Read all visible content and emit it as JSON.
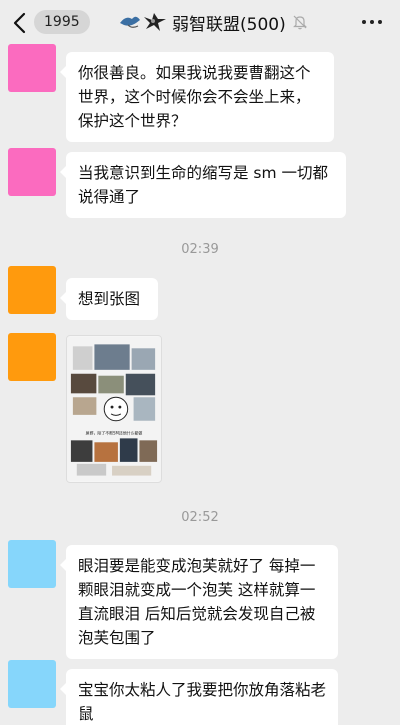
{
  "header": {
    "back_count": "1995",
    "title": "弱智联盟(500)"
  },
  "colors": {
    "pink": "#fb6bbf",
    "orange": "#ff9a0d",
    "blue": "#86d6fb",
    "bubble": "#ffffff",
    "background": "#ededed"
  },
  "icons": {
    "back": "chevron-left-icon",
    "group": "group-avatar-icon",
    "mute": "bell-off-icon",
    "more": "ellipsis-icon"
  },
  "messages": [
    {
      "avatar_color": "pink",
      "text": "你很善良。如果我说我要曹翻这个世界，这个时候你会不会坐上来，保护这个世界？"
    },
    {
      "avatar_color": "pink",
      "text": "当我意识到生命的缩写是 sm 一切都说得通了"
    },
    {
      "avatar_color": "orange",
      "text": "想到张图"
    },
    {
      "avatar_color": "orange",
      "image_caption": "屌群，除了不断SM还他什么都做",
      "image_label": "collage-image"
    },
    {
      "avatar_color": "blue",
      "text": "眼泪要是能变成泡芙就好了 每掉一颗眼泪就变成一个泡芙 这样就算一直流眼泪 后知后觉就会发现自己被泡芙包围了"
    },
    {
      "avatar_color": "blue",
      "text": "宝宝你太粘人了我要把你放角落粘老鼠"
    }
  ],
  "times": [
    "02:39",
    "02:52"
  ]
}
